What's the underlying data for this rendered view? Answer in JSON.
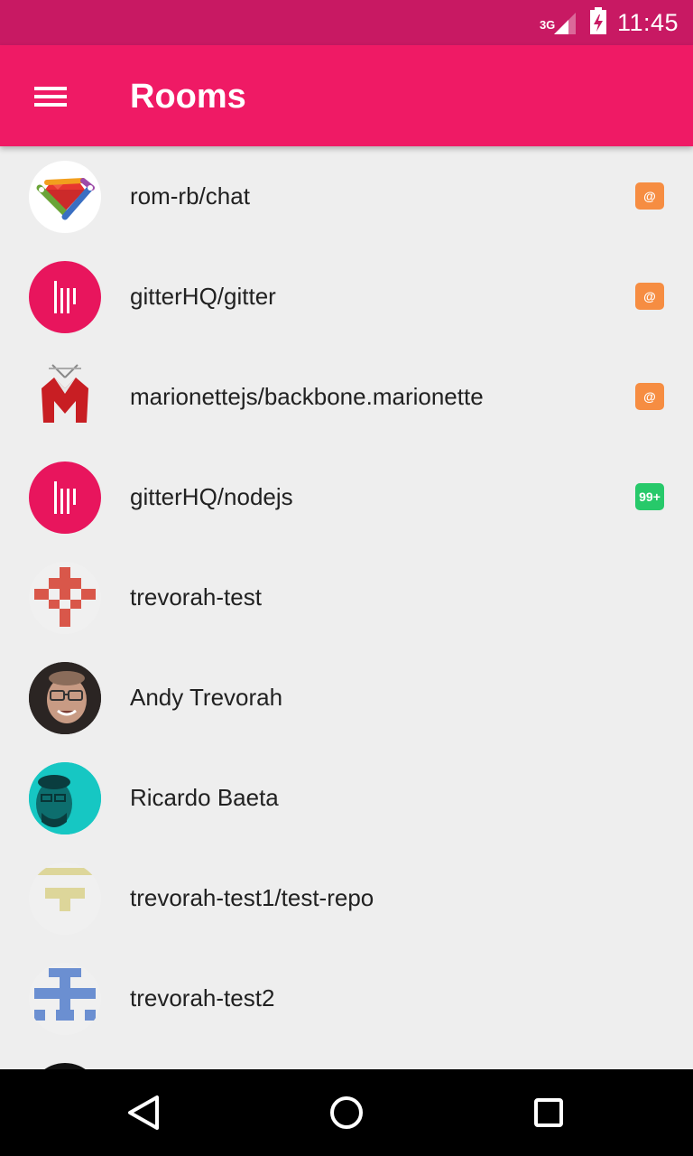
{
  "status_bar": {
    "network": "3G",
    "time": "11:45"
  },
  "app_bar": {
    "title": "Rooms",
    "menu_icon": "hamburger-menu-icon"
  },
  "colors": {
    "status_bar": "#c81963",
    "app_bar": "#ef1a65",
    "mention_badge": "#f68d42",
    "unread_badge": "#27c96a"
  },
  "rooms": [
    {
      "name": "rom-rb/chat",
      "avatar": "rom-rb-ruby-logo",
      "badge": "@",
      "badge_type": "mention"
    },
    {
      "name": "gitterHQ/gitter",
      "avatar": "gitter-logo",
      "badge": "@",
      "badge_type": "mention"
    },
    {
      "name": "marionettejs/backbone.marionette",
      "avatar": "marionette-logo",
      "badge": "@",
      "badge_type": "mention"
    },
    {
      "name": "gitterHQ/nodejs",
      "avatar": "gitter-logo",
      "badge": "99+",
      "badge_type": "unread"
    },
    {
      "name": "trevorah-test",
      "avatar": "identicon-red",
      "badge": "",
      "badge_type": ""
    },
    {
      "name": "Andy Trevorah",
      "avatar": "user-photo",
      "badge": "",
      "badge_type": ""
    },
    {
      "name": "Ricardo Baeta",
      "avatar": "user-photo",
      "badge": "",
      "badge_type": ""
    },
    {
      "name": "trevorah-test1/test-repo",
      "avatar": "identicon-yellow",
      "badge": "",
      "badge_type": ""
    },
    {
      "name": "trevorah-test2",
      "avatar": "identicon-blue",
      "badge": "",
      "badge_type": ""
    }
  ],
  "nav": {
    "back": "back-icon",
    "home": "home-icon",
    "recents": "recents-icon"
  }
}
